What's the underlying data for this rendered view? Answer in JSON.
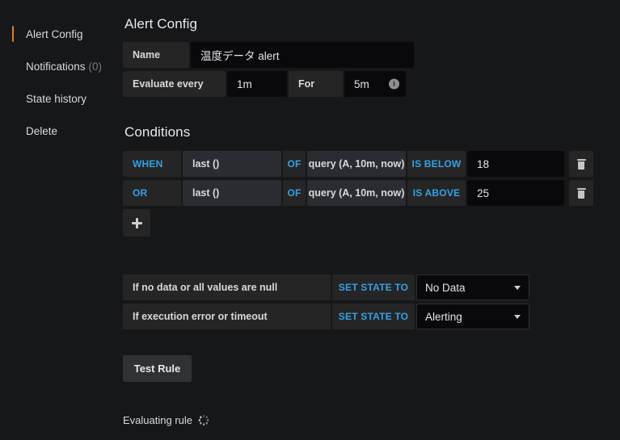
{
  "sidebar": {
    "items": [
      {
        "label": "Alert Config",
        "count": "",
        "active": true
      },
      {
        "label": "Notifications",
        "count": "(0)",
        "active": false
      },
      {
        "label": "State history",
        "count": "",
        "active": false
      },
      {
        "label": "Delete",
        "count": "",
        "active": false
      }
    ]
  },
  "main": {
    "title": "Alert Config",
    "name_row": {
      "label": "Name",
      "value": "温度データ alert"
    },
    "evaluate_row": {
      "evaluate_label": "Evaluate every",
      "evaluate_value": "1m",
      "for_label": "For",
      "for_value": "5m",
      "info_glyph": "i"
    },
    "conditions_title": "Conditions",
    "conditions": [
      {
        "operator": "WHEN",
        "reducer": "last ()",
        "of": "OF",
        "query": "query (A, 10m, now)",
        "comparator": "IS BELOW",
        "value": "18"
      },
      {
        "operator": "OR",
        "reducer": "last ()",
        "of": "OF",
        "query": "query (A, 10m, now)",
        "comparator": "IS ABOVE",
        "value": "25"
      }
    ],
    "handling": [
      {
        "label": "If no data or all values are null",
        "set_state_to": "SET STATE TO",
        "state": "No Data"
      },
      {
        "label": "If execution error or timeout",
        "set_state_to": "SET STATE TO",
        "state": "Alerting"
      }
    ],
    "test_button": "Test Rule",
    "status": "Evaluating rule"
  },
  "colors": {
    "background": "#161719",
    "accent_orange": "#eb7b18",
    "accent_blue": "#33a2e5",
    "cell_bg": "#252525",
    "input_bg": "#09090b"
  }
}
